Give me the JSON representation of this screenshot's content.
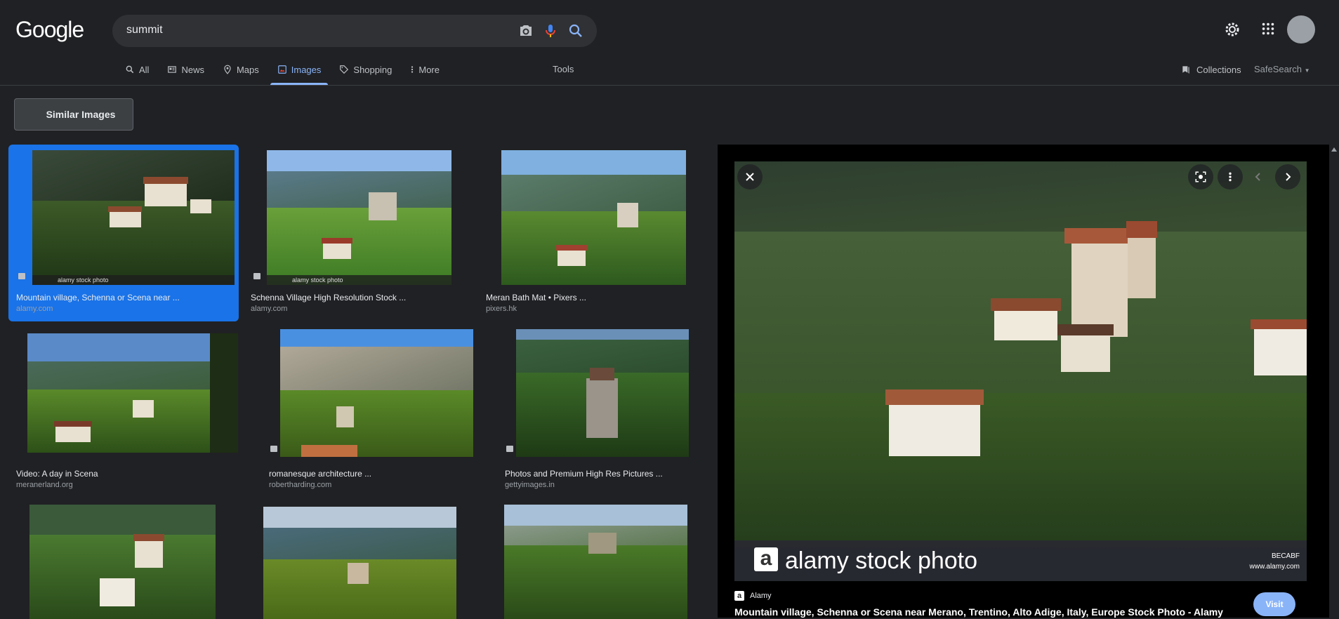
{
  "header": {
    "logo": "Google",
    "search_value": "summit",
    "nav": [
      {
        "label": "All",
        "icon": "search-icon"
      },
      {
        "label": "News",
        "icon": "news-icon"
      },
      {
        "label": "Maps",
        "icon": "map-pin-icon"
      },
      {
        "label": "Images",
        "icon": "image-icon",
        "active": true
      },
      {
        "label": "Shopping",
        "icon": "tag-icon"
      },
      {
        "label": "More",
        "icon": "more-vert-icon"
      }
    ],
    "tools": "Tools",
    "collections": "Collections",
    "safesearch": "SafeSearch"
  },
  "similar_images_label": "Similar Images",
  "results": [
    {
      "title": "Mountain village, Schenna or Scena near ...",
      "source": "alamy.com",
      "watermark": "alamy stock photo",
      "selected": true
    },
    {
      "title": "Schenna Village High Resolution Stock ...",
      "source": "alamy.com",
      "watermark": "alamy stock photo"
    },
    {
      "title": "Meran Bath Mat • Pixers ...",
      "source": "pixers.hk"
    },
    {
      "title": "Video: A day in Scena",
      "source": "meranerland.org"
    },
    {
      "title": "romanesque architecture ...",
      "source": "robertharding.com"
    },
    {
      "title": "Photos and Premium High Res Pictures ...",
      "source": "gettyimages.in"
    }
  ],
  "preview": {
    "stock_text": "alamy stock photo",
    "stock_id": "BECABF",
    "stock_url": "www.alamy.com",
    "source_name": "Alamy",
    "title": "Mountain village, Schenna or Scena near Merano, Trentino, Alto Adige, Italy, Europe Stock Photo - Alamy",
    "visit_label": "Visit"
  },
  "colors": {
    "accent": "#8ab4f8",
    "selected": "#1a73e8",
    "background": "#202124"
  }
}
